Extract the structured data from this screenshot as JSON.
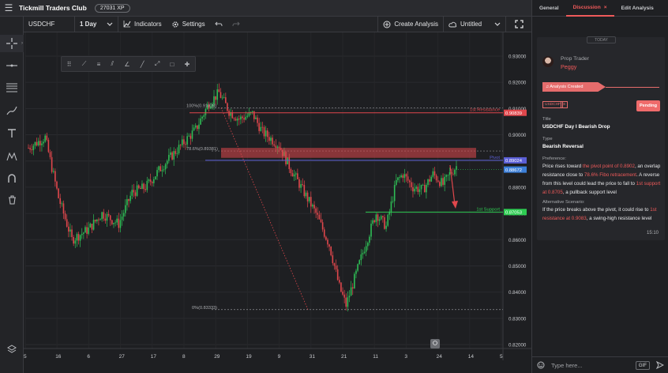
{
  "topbar": {
    "club_name": "Tickmill Traders Club",
    "xp_badge": "27031 XP"
  },
  "toolbar": {
    "symbol": "USDCHF",
    "interval": "1 Day",
    "indicators_label": "Indicators",
    "settings_label": "Settings",
    "create_analysis_label": "Create Analysis",
    "untitled_label": "Untitled"
  },
  "panel": {
    "tabs": [
      "General",
      "Discussion",
      "Edit Analysis"
    ],
    "active_tab": "Discussion",
    "tab_close": "×",
    "today_label": "TODAY",
    "author_role": "Prop Trader",
    "author_name": "Peggy",
    "event_label": "Analysis Created",
    "symbol_badge": "USDCHF",
    "direction_badge": "S",
    "status_label": "Pending",
    "title_label": "Title",
    "title_value": "USDCHF Day I Bearish Drop",
    "type_label": "Type",
    "type_value": "Bearish Reversal",
    "preference_label": "Preference:",
    "preference_parts": [
      "Price rises toward ",
      "the pivot point of 0.8902",
      ", an overlap resistance close to ",
      "78.6% Fibo retracement",
      ". A reverse from this level could lead the price to fall to ",
      "1st support at 0.8705",
      ", a pullback support level"
    ],
    "alternative_label": "Alternative Scenario:",
    "alternative_parts": [
      "If the price breaks above the pivot, it could rise to ",
      "1st resistance at 0.9083",
      ", a swing-high resistance level"
    ],
    "time": "15:10",
    "composer_placeholder": "Type here...",
    "gif_label": "GIF"
  },
  "chart_data": {
    "type": "candlestick",
    "symbol": "USDCHF",
    "interval": "1 Day",
    "y_ticks": [
      0.93,
      0.92,
      0.91,
      0.9,
      0.89,
      0.88,
      0.87,
      0.86,
      0.85,
      0.84,
      0.83,
      0.82
    ],
    "y_tick_labels": [
      "0.93000",
      "0.92000",
      "0.91000",
      "0.90000",
      "0.89000",
      "0.88000",
      "0.87000",
      "0.86000",
      "0.85000",
      "0.84000",
      "0.83000",
      "0.82000"
    ],
    "x_tick_labels": [
      "5",
      "16",
      "6",
      "27",
      "17",
      "8",
      "29",
      "19",
      "9",
      "31",
      "21",
      "11",
      "3",
      "24",
      "14",
      "5"
    ],
    "levels": [
      {
        "name": "1st Resistance",
        "value": 0.90839,
        "color": "#e0474c",
        "label": "0.90839"
      },
      {
        "name": "Pivot",
        "value": 0.89024,
        "color": "#5b5fd6",
        "label": "0.89024"
      },
      {
        "name": "1st Support",
        "value": 0.87053,
        "color": "#2ecc52",
        "label": "0.87053"
      }
    ],
    "current_price_label": "0.88672",
    "current_price": 0.88672,
    "fib_levels": [
      {
        "label": "100%(0.91028)",
        "value": 0.91028
      },
      {
        "label": "78.6%(0.89381)",
        "value": 0.89381
      },
      {
        "label": "0%(0.83333)",
        "value": 0.83333
      }
    ],
    "zone": {
      "from": 0.8912,
      "to": 0.895
    },
    "colors": {
      "up": "#2ebd55",
      "down": "#e0474c"
    }
  }
}
